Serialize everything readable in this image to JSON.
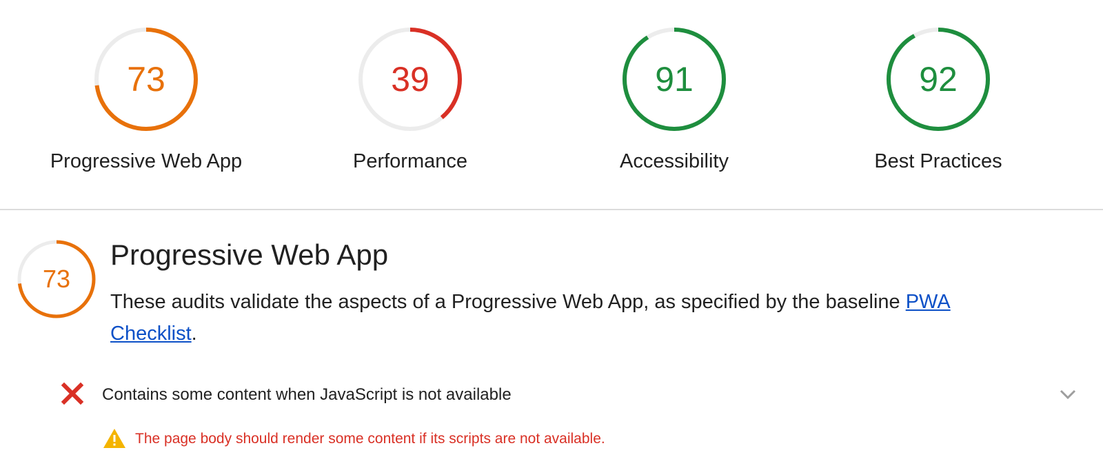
{
  "colors": {
    "average": "#e8710a",
    "fail": "#d93025",
    "pass": "#1e8e3e",
    "track": "#ececec",
    "link": "#0c50c7",
    "warning": "#f4b400"
  },
  "gauges": [
    {
      "score": "73",
      "label": "Progressive Web App",
      "rating": "average"
    },
    {
      "score": "39",
      "label": "Performance",
      "rating": "fail"
    },
    {
      "score": "91",
      "label": "Accessibility",
      "rating": "pass"
    },
    {
      "score": "92",
      "label": "Best Practices",
      "rating": "pass"
    }
  ],
  "category": {
    "score": "73",
    "rating": "average",
    "title": "Progressive Web App",
    "description_prefix": "These audits validate the aspects of a Progressive Web App, as specified by the baseline ",
    "link_text": "PWA Checklist",
    "description_suffix": "."
  },
  "audit": {
    "status_icon": "fail-x-icon",
    "title": "Contains some content when JavaScript is not available",
    "expand_icon": "chevron-down-icon",
    "warning_icon": "warning-triangle-icon",
    "warning": "The page body should render some content if its scripts are not available."
  }
}
